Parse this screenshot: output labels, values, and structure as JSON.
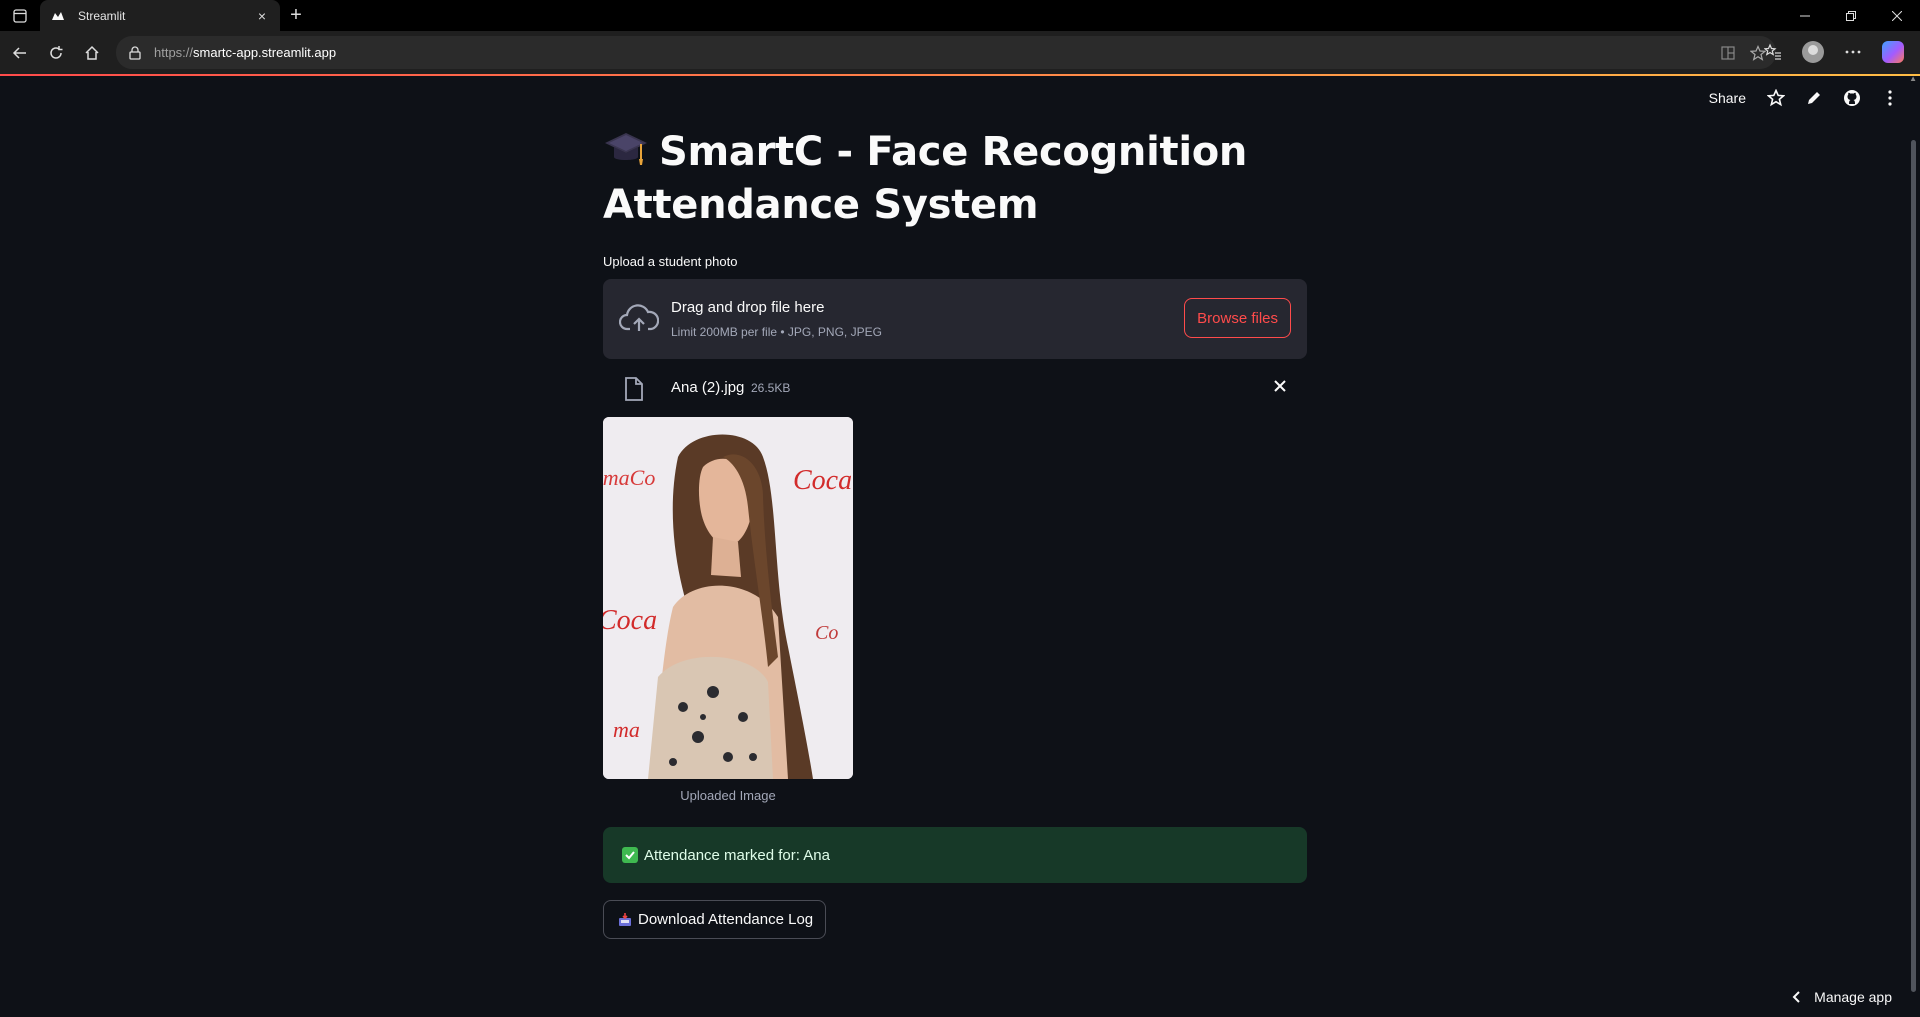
{
  "browser": {
    "tab_title": "Streamlit",
    "url_scheme": "https://",
    "url_host": "smartc-app.streamlit.app",
    "new_tab_symbol": "+",
    "tab_close_symbol": "×"
  },
  "app_header": {
    "share_label": "Share"
  },
  "main": {
    "title": "SmartC - Face Recognition Attendance System",
    "uploader": {
      "label": "Upload a student photo",
      "drag_text": "Drag and drop file here",
      "limit_text": "Limit 200MB per file • JPG, PNG, JPEG",
      "browse_label": "Browse files"
    },
    "uploaded_file": {
      "name": "Ana (2).jpg",
      "size": "26.5KB"
    },
    "image": {
      "caption": "Uploaded Image"
    },
    "success": {
      "text": "Attendance marked for: Ana"
    },
    "download_label": "Download Attendance Log"
  },
  "footer": {
    "manage_app_label": "Manage app"
  },
  "colors": {
    "background": "#0e1117",
    "accent": "#ff4b4b",
    "success_bg": "#173928",
    "dropzone_bg": "#262730"
  }
}
